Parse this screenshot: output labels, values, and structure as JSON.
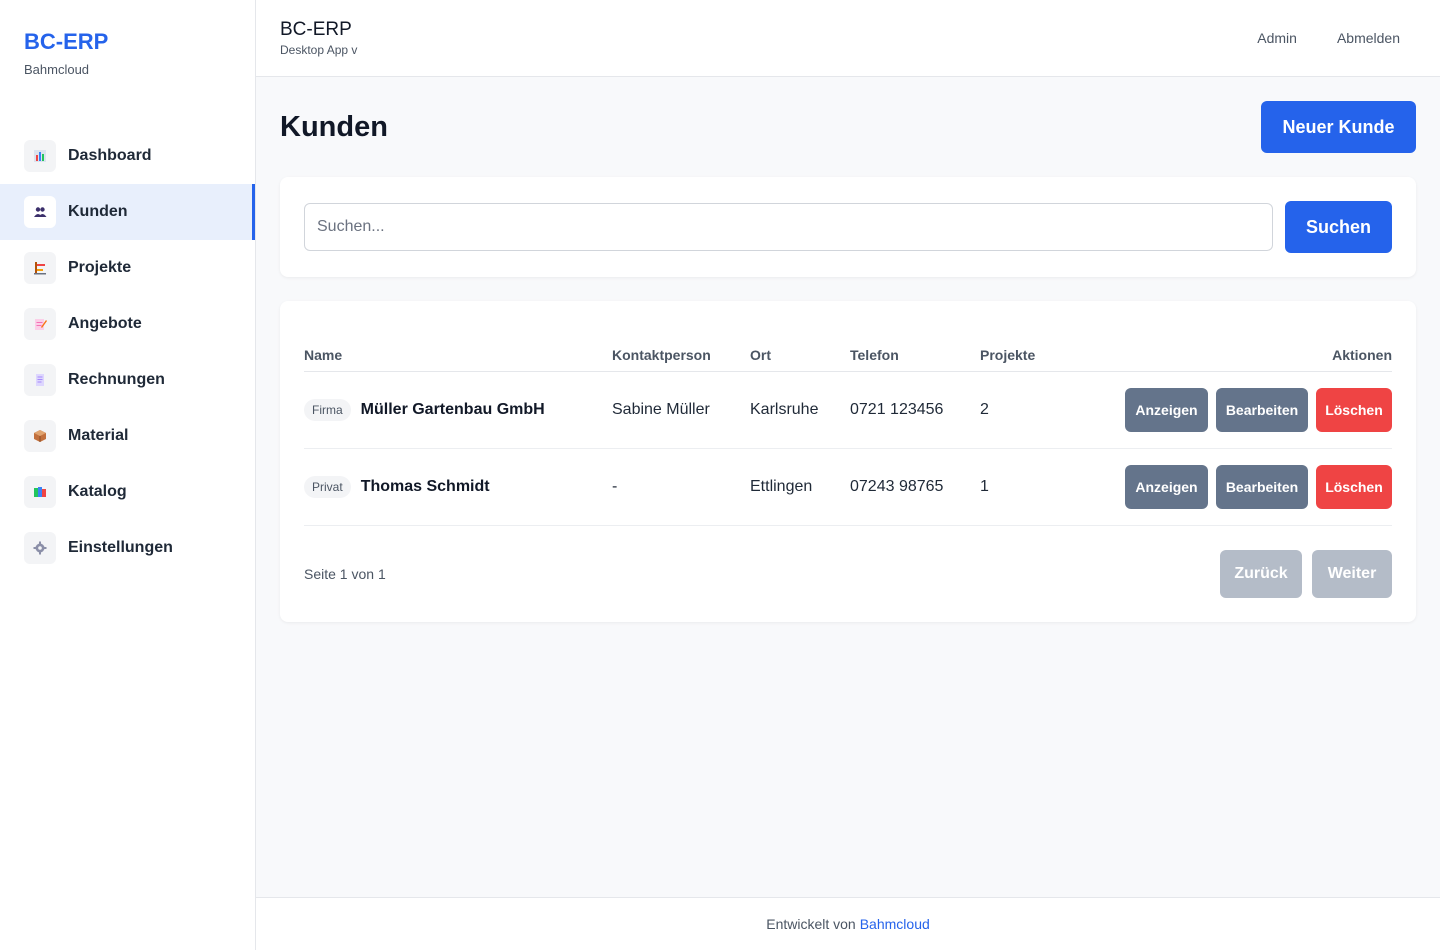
{
  "brand": {
    "title": "BC-ERP",
    "subtitle": "Bahmcloud"
  },
  "sidebar": {
    "items": [
      {
        "label": "Dashboard",
        "icon": "bar-chart-icon"
      },
      {
        "label": "Kunden",
        "icon": "users-icon",
        "active": true
      },
      {
        "label": "Projekte",
        "icon": "construction-icon"
      },
      {
        "label": "Angebote",
        "icon": "document-pencil-icon"
      },
      {
        "label": "Rechnungen",
        "icon": "receipt-icon"
      },
      {
        "label": "Material",
        "icon": "package-icon"
      },
      {
        "label": "Katalog",
        "icon": "books-icon"
      },
      {
        "label": "Einstellungen",
        "icon": "gear-icon"
      }
    ]
  },
  "topbar": {
    "title": "BC-ERP",
    "subtitle": "Desktop App v",
    "user_link": "Admin",
    "logout_link": "Abmelden"
  },
  "page": {
    "title": "Kunden",
    "new_button": "Neuer Kunde"
  },
  "search": {
    "placeholder": "Suchen...",
    "value": "",
    "button": "Suchen"
  },
  "table": {
    "columns": [
      "Name",
      "Kontaktperson",
      "Ort",
      "Telefon",
      "Projekte",
      "Aktionen"
    ],
    "rows": [
      {
        "type": "Firma",
        "name": "Müller Gartenbau GmbH",
        "contact": "Sabine Müller",
        "city": "Karlsruhe",
        "phone": "0721 123456",
        "projects": "2"
      },
      {
        "type": "Privat",
        "name": "Thomas Schmidt",
        "contact": "-",
        "city": "Ettlingen",
        "phone": "07243 98765",
        "projects": "1"
      }
    ],
    "actions": {
      "show": "Anzeigen",
      "edit": "Bearbeiten",
      "delete": "Löschen"
    }
  },
  "pager": {
    "info": "Seite 1 von 1",
    "back": "Zurück",
    "next": "Weiter"
  },
  "footer": {
    "text": "Entwickelt von",
    "link": "Bahmcloud"
  },
  "colors": {
    "accent": "#2563eb",
    "danger": "#ef4444",
    "secondary": "#64748b",
    "disabled": "#b4bcc8"
  }
}
